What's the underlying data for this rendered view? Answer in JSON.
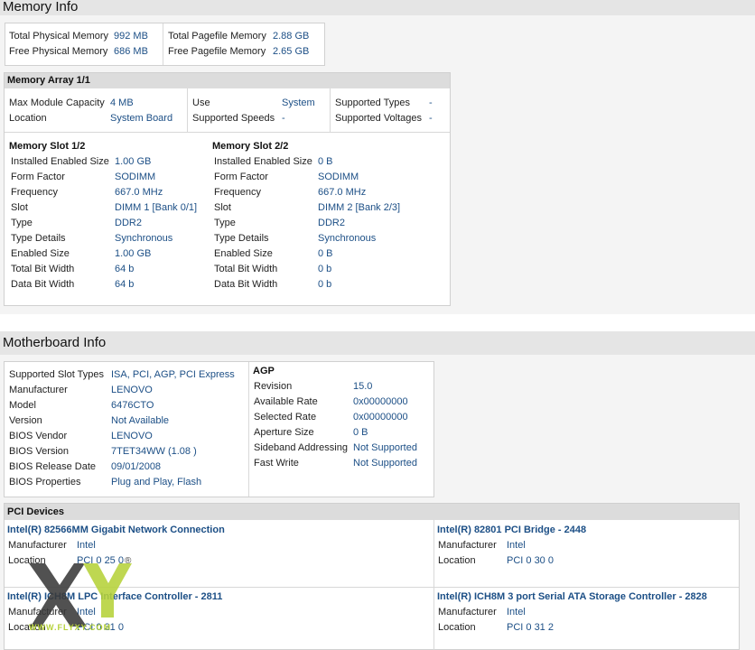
{
  "memory": {
    "title": "Memory Info",
    "summary": {
      "total_physical_label": "Total Physical Memory",
      "total_physical_value": "992 MB",
      "free_physical_label": "Free Physical Memory",
      "free_physical_value": "686 MB",
      "total_pagefile_label": "Total Pagefile Memory",
      "total_pagefile_value": "2.88 GB",
      "free_pagefile_label": "Free Pagefile Memory",
      "free_pagefile_value": "2.65 GB"
    },
    "array": {
      "title": "Memory Array 1/1",
      "max_module_label": "Max Module Capacity",
      "max_module_value": "4 MB",
      "location_label": "Location",
      "location_value": "System Board",
      "use_label": "Use",
      "use_value": "System",
      "supported_speeds_label": "Supported Speeds",
      "supported_speeds_value": "-",
      "supported_types_label": "Supported Types",
      "supported_types_value": "-",
      "supported_voltages_label": "Supported Voltages",
      "supported_voltages_value": "-"
    },
    "slots": [
      {
        "title": "Memory Slot 1/2",
        "rows": [
          [
            "Installed Enabled Size",
            "1.00 GB"
          ],
          [
            "Form Factor",
            "SODIMM"
          ],
          [
            "Frequency",
            "667.0 MHz"
          ],
          [
            "Slot",
            "DIMM 1 [Bank 0/1]"
          ],
          [
            "Type",
            "DDR2"
          ],
          [
            "Type Details",
            "Synchronous"
          ],
          [
            "Enabled Size",
            "1.00 GB"
          ],
          [
            "Total Bit Width",
            "64 b"
          ],
          [
            "Data Bit Width",
            "64 b"
          ]
        ]
      },
      {
        "title": "Memory Slot 2/2",
        "rows": [
          [
            "Installed Enabled Size",
            "0 B"
          ],
          [
            "Form Factor",
            "SODIMM"
          ],
          [
            "Frequency",
            "667.0 MHz"
          ],
          [
            "Slot",
            "DIMM 2 [Bank 2/3]"
          ],
          [
            "Type",
            "DDR2"
          ],
          [
            "Type Details",
            "Synchronous"
          ],
          [
            "Enabled Size",
            "0 B"
          ],
          [
            "Total Bit Width",
            "0 b"
          ],
          [
            "Data Bit Width",
            "0 b"
          ]
        ]
      }
    ]
  },
  "motherboard": {
    "title": "Motherboard Info",
    "rows": [
      [
        "Supported Slot Types",
        "ISA, PCI, AGP, PCI Express"
      ],
      [
        "Manufacturer",
        "LENOVO"
      ],
      [
        "Model",
        "6476CTO"
      ],
      [
        "Version",
        "Not Available"
      ],
      [
        "BIOS Vendor",
        "LENOVO"
      ],
      [
        "BIOS Version",
        "7TET34WW (1.08 )"
      ],
      [
        "BIOS Release Date",
        "09/01/2008"
      ],
      [
        "BIOS Properties",
        "Plug and Play, Flash"
      ]
    ],
    "agp": {
      "title": "AGP",
      "rows": [
        [
          "Revision",
          "15.0"
        ],
        [
          "Available Rate",
          "0x00000000"
        ],
        [
          "Selected Rate",
          "0x00000000"
        ],
        [
          "Aperture Size",
          "0 B"
        ],
        [
          "Sideband Addressing",
          "Not Supported"
        ],
        [
          "Fast Write",
          "Not Supported"
        ]
      ]
    },
    "pci": {
      "title": "PCI Devices",
      "manufacturer_label": "Manufacturer",
      "location_label": "Location",
      "devices": [
        {
          "name": "Intel(R) 82566MM Gigabit Network Connection",
          "manufacturer": "Intel",
          "location": "PCI 0 25 0"
        },
        {
          "name": "Intel(R) 82801 PCI Bridge - 2448",
          "manufacturer": "Intel",
          "location": "PCI 0 30 0"
        },
        {
          "name": "Intel(R) ICH8M LPC Interface Controller - 2811",
          "manufacturer": "Intel",
          "location": "PCI 0 31 0"
        },
        {
          "name": "Intel(R) ICH8M 3 port Serial ATA Storage Controller - 2828",
          "manufacturer": "Intel",
          "location": "PCI 0 31 2"
        }
      ]
    }
  },
  "watermark": {
    "logo_text": "XY",
    "site_text": "WWW.FLYXY.COM",
    "registered_mark": "®",
    "colors": {
      "x": "#3a3a3a",
      "y": "#b6d23a"
    }
  }
}
